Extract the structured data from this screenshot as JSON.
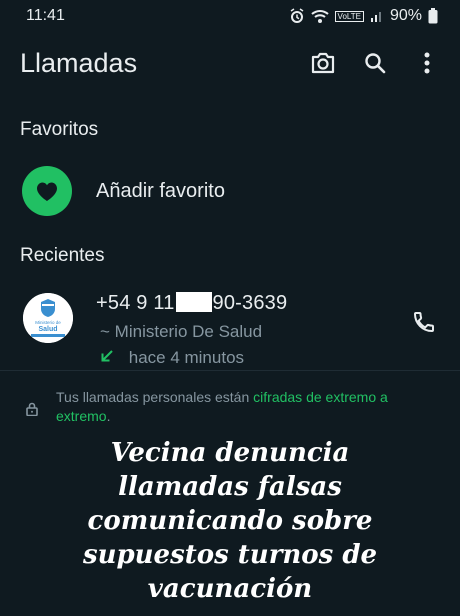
{
  "status_bar": {
    "time": "11:41",
    "network": "VoLTE",
    "battery": "90%"
  },
  "app_bar": {
    "title": "Llamadas"
  },
  "favorites": {
    "heading": "Favoritos",
    "add_label": "Añadir favorito"
  },
  "recents": {
    "heading": "Recientes",
    "calls": [
      {
        "number_prefix": "+54 9 11",
        "number_suffix": "90-3639",
        "name_prefix": "~",
        "name": "Ministerio De Salud",
        "time": "hace 4 minutos",
        "avatar_text": [
          "Ministerio de",
          "Salud"
        ]
      }
    ]
  },
  "encryption": {
    "text": "Tus llamadas personales están ",
    "link": "cifradas de extremo a extremo",
    "suffix": "."
  },
  "headline": {
    "lines": [
      "Vecina denuncia",
      "llamadas falsas",
      "comunicando sobre",
      "supuestos turnos de",
      "vacunación"
    ]
  },
  "colors": {
    "accent": "#21c063",
    "background": "#0f1a20",
    "secondary_text": "#8696a0"
  },
  "icons": {
    "status": [
      "alarm-icon",
      "wifi-icon",
      "signal-icon",
      "battery-icon"
    ],
    "app_bar": [
      "camera-icon",
      "search-icon",
      "more-vert-icon"
    ],
    "favorite": "heart-icon",
    "call_type": "incoming-call-arrow-icon",
    "call_action": "phone-icon",
    "encryption": "lock-icon"
  }
}
